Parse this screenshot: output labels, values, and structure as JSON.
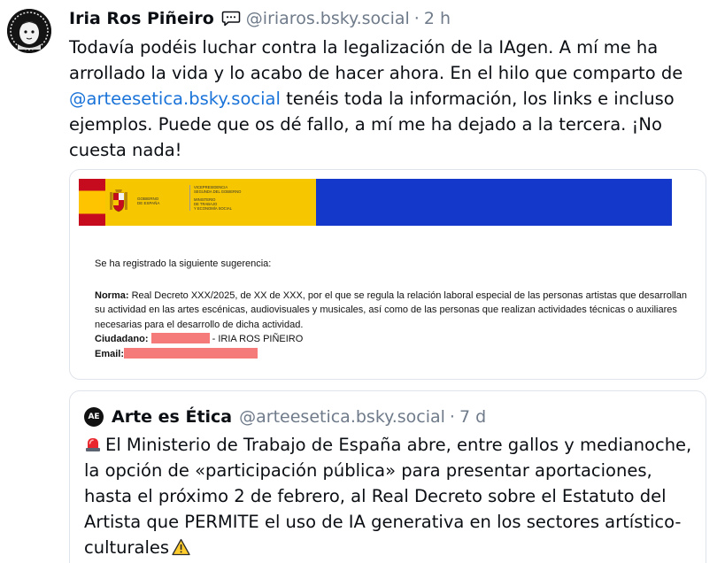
{
  "post": {
    "author": "Iria Ros Piñeiro",
    "handle": "@iriaros.bsky.social",
    "separator": "·",
    "time": "2 h",
    "text_before": "Todavía podéis luchar contra la legalización de la IAgen. A mí me ha arrollado la vida y lo acabo de hacer ahora. En el hilo que comparto de ",
    "mention": "@arteesetica.bsky.social",
    "text_after": " tenéis toda la información, los links e incluso ejemplos. Puede que os dé fallo, a mí me ha dejado a la tercera. ¡No cuesta nada!"
  },
  "image": {
    "gov": {
      "line1": "GOBIERNO",
      "line2": "DE ESPAÑA",
      "right1": "VICEPRESIDENCIA",
      "right2": "SEGUNDA DEL GOBIERNO",
      "right3": "MINISTERIO",
      "right4": "DE TRABAJO",
      "right5": "Y ECONOMÍA SOCIAL"
    },
    "intro": "Se ha registrado la siguiente sugerencia:",
    "norma_label": "Norma:",
    "norma_text": " Real Decreto XXX/2025, de XX de XXX, por el que se regula la relación laboral especial de las personas artistas que desarrollan su actividad en las artes escénicas, audiovisuales y musicales, así como de las personas que realizan actividades técnicas o auxiliares necesarias para el desarrollo de dicha actividad.",
    "ciudadano_label": "Ciudadano:",
    "ciudadano_suffix": " - IRIA ROS PIÑEIRO",
    "email_label": "Email:"
  },
  "quote": {
    "avatar_text": "AE",
    "author": "Arte es Ética",
    "handle": "@arteesetica.bsky.social",
    "separator": "·",
    "time": "7 d",
    "text": "El Ministerio de Trabajo de España abre, entre gallos y medianoche, la opción de «participación pública» para presentar aportaciones, hasta el próximo 2 de febrero, al Real Decreto sobre el Estatuto del Artista que PERMITE el uso de IA generativa en los sectores artístico-culturales"
  },
  "icons": {
    "chat": "speech-bubble-icon",
    "siren": "rotating-light-icon",
    "warning": "warning-icon"
  },
  "colors": {
    "link": "#1a73d9",
    "muted": "#6f7b8a",
    "redaction": "#f57b7b",
    "gov_blue": "#1438c9",
    "gov_yellow": "#f6c600"
  }
}
